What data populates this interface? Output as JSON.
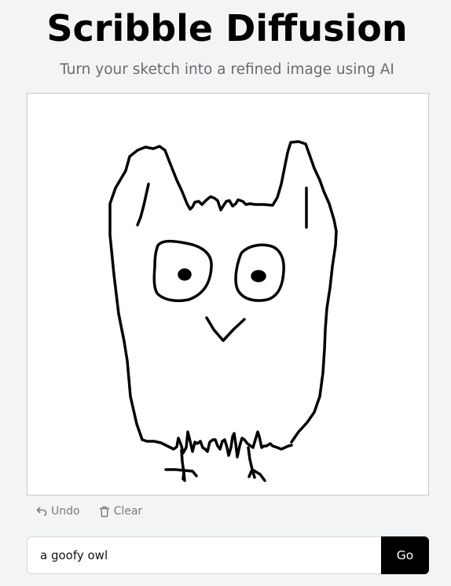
{
  "header": {
    "title": "Scribble Diffusion",
    "subtitle": "Turn your sketch into a refined image using AI"
  },
  "canvas": {
    "drawing_subject": "owl sketch",
    "stroke_color": "#000000",
    "background_color": "#ffffff"
  },
  "toolbar": {
    "undo_label": "Undo",
    "undo_icon": "undo-arrow-icon",
    "clear_label": "Clear",
    "clear_icon": "trash-icon"
  },
  "prompt": {
    "value": "a goofy owl",
    "submit_label": "Go"
  },
  "colors": {
    "page_background": "#f3f4f6",
    "title": "#000000",
    "subtitle": "#6b6b70",
    "button_background": "#000000",
    "button_text": "#ffffff",
    "tool_text": "#7a7a80"
  }
}
